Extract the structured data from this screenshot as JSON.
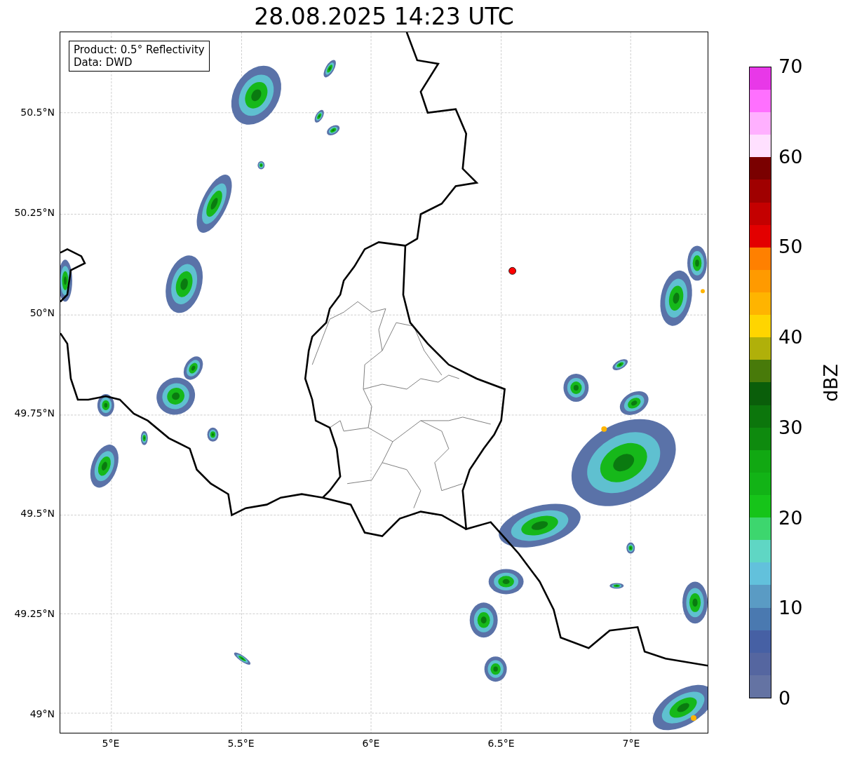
{
  "title": "28.08.2025 14:23 UTC",
  "info_box": {
    "lines": [
      "Product: 0.5° Reflectivity",
      "Data: DWD"
    ]
  },
  "map": {
    "y_ticks": [
      "50.5°N",
      "50.25°N",
      "50°N",
      "49.75°N",
      "49.5°N",
      "49.25°N",
      "49°N"
    ],
    "x_ticks": [
      "5°E",
      "5.5°E",
      "6°E",
      "6.5°E",
      "7°E"
    ]
  },
  "colorbar": {
    "label": "dBZ",
    "ticks": [
      "70",
      "60",
      "50",
      "40",
      "30",
      "20",
      "10",
      "0"
    ],
    "bins": [
      {
        "color": "#6473a3"
      },
      {
        "color": "#5566a0"
      },
      {
        "color": "#4660a4"
      },
      {
        "color": "#4a79b0"
      },
      {
        "color": "#5a9bc4"
      },
      {
        "color": "#62c1dc"
      },
      {
        "color": "#5fd6c4"
      },
      {
        "color": "#3dd66e"
      },
      {
        "color": "#16c419"
      },
      {
        "color": "#12b316"
      },
      {
        "color": "#11a812"
      },
      {
        "color": "#0e8a0e"
      },
      {
        "color": "#0c760c"
      },
      {
        "color": "#0a5e0a"
      },
      {
        "color": "#487a0a"
      },
      {
        "color": "#b0b00a"
      },
      {
        "color": "#ffd500"
      },
      {
        "color": "#ffb400"
      },
      {
        "color": "#ff9a00"
      },
      {
        "color": "#ff8000"
      },
      {
        "color": "#e30000"
      },
      {
        "color": "#c40000"
      },
      {
        "color": "#a00000"
      },
      {
        "color": "#7a0000"
      },
      {
        "color": "#ffe0ff"
      },
      {
        "color": "#ffb0ff"
      },
      {
        "color": "#ff70ff"
      },
      {
        "color": "#e838e8"
      }
    ]
  }
}
